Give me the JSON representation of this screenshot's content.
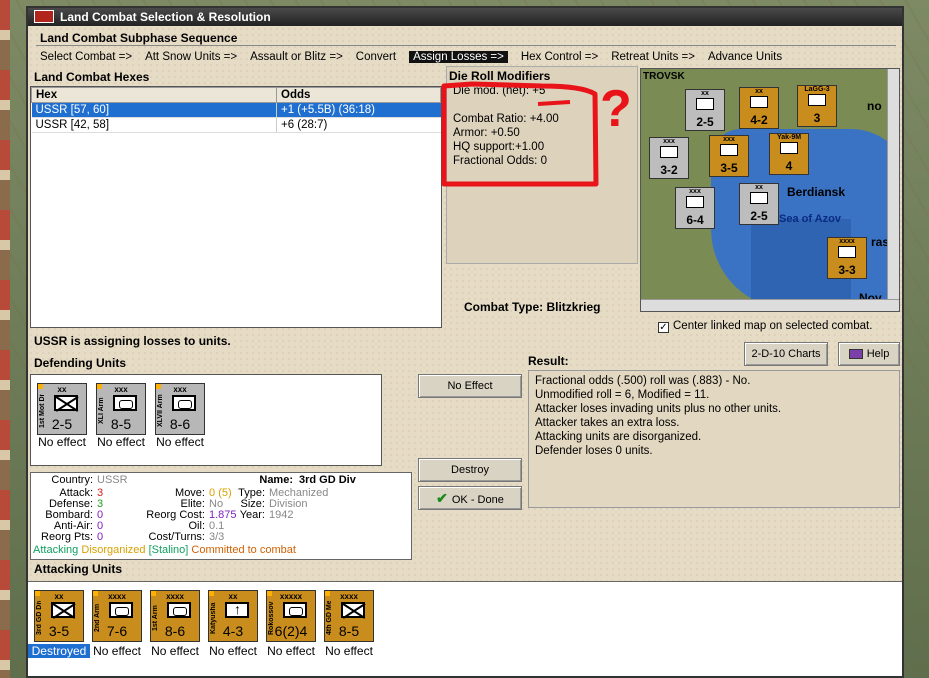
{
  "window": {
    "title": "Land Combat Selection & Resolution"
  },
  "subphase": {
    "heading": "Land Combat Subphase Sequence",
    "steps": [
      "Select Combat =>",
      "Att Snow Units =>",
      "Assault or Blitz =>",
      "Convert",
      "Assign Losses =>",
      "Hex Control =>",
      "Retreat Units =>",
      "Advance Units"
    ],
    "active_index": 4
  },
  "hexes": {
    "heading": "Land Combat Hexes",
    "columns": [
      "Hex",
      "Odds"
    ],
    "rows": [
      {
        "hex": "USSR [57, 60]",
        "odds": "+1 (+5.5B) (36:18)"
      },
      {
        "hex": "USSR [42, 58]",
        "odds": "+6 (28:7)"
      }
    ]
  },
  "die_roll": {
    "heading": "Die Roll Modifiers",
    "net": "Die mod. (net): +5",
    "combat_ratio": "Combat Ratio: +4.00",
    "armor": "Armor: +0.50",
    "hq_support": "HQ support:+1.00",
    "fractional_odds": "Fractional Odds: 0"
  },
  "annotation": {
    "mark": "?",
    "color": "#e8141a"
  },
  "combat_type": "Combat Type:  Blitzkrieg",
  "center_map": {
    "label": "Center linked map on selected combat.",
    "checked": "✓"
  },
  "minimap": {
    "labels": {
      "city": "Berdiansk",
      "sea": "Sea of Azov",
      "frag1": "TROVSK",
      "frag2": "no",
      "frag3": "ras",
      "frag4": "Nov"
    },
    "counters": [
      {
        "value": "2-5",
        "top": "xx"
      },
      {
        "value": "4-2",
        "top": "xx"
      },
      {
        "value": "3",
        "top": "LaGG-3"
      },
      {
        "value": "3-2",
        "top": "xxx"
      },
      {
        "value": "3-5",
        "top": "xxx"
      },
      {
        "value": "4",
        "top": "Yak-9M"
      },
      {
        "value": "6-4",
        "top": "xxx"
      },
      {
        "value": "2-5",
        "top": "xx"
      },
      {
        "value": "3-3",
        "top": "xxxx"
      }
    ]
  },
  "status_text": "USSR is assigning losses to units.",
  "defending": {
    "heading": "Defending Units",
    "units": [
      {
        "size": "xx",
        "name": "1st Mot Div",
        "strength": "2-5",
        "effect": "No effect",
        "symbol": "x",
        "color": "grey"
      },
      {
        "size": "xxx",
        "name": "XLI Arm",
        "strength": "8-5",
        "effect": "No effect",
        "symbol": "box",
        "color": "grey"
      },
      {
        "size": "xxx",
        "name": "XLVII Arm",
        "strength": "8-6",
        "effect": "No effect",
        "symbol": "box",
        "color": "grey"
      }
    ]
  },
  "buttons": {
    "no_effect": "No Effect",
    "destroy": "Destroy",
    "ok_done": "OK - Done",
    "charts": "2-D-10 Charts",
    "help": "Help"
  },
  "result": {
    "heading": "Result:",
    "lines": [
      "Fractional odds (.500) roll was (.883)  - No.",
      "Unmodified roll = 6, Modified = 11.",
      "Attacker loses invading units plus no other units.",
      "Attacker takes an extra loss.",
      "Attacking units are disorganized.",
      "Defender loses 0 units."
    ]
  },
  "unit_info": {
    "country_label": "Country:",
    "country": "USSR",
    "attack_label": "Attack:",
    "attack": "3",
    "defense_label": "Defense:",
    "defense": "3",
    "bombard_label": "Bombard:",
    "bombard": "0",
    "antiair_label": "Anti-Air:",
    "antiair": "0",
    "reorg_label": "Reorg Pts:",
    "reorg": "0",
    "move_label": "Move:",
    "move": "0",
    "move_paren": "(5)",
    "elite_label": "Elite:",
    "elite": "No",
    "reorg_cost_label": "Reorg Cost:",
    "reorg_cost": "1.875",
    "oil_label": "Oil:",
    "oil": "0.1",
    "cost_label": "Cost/Turns:",
    "cost": "3/3",
    "name_label": "Name:",
    "name": "3rd GD Div",
    "type_label": "Type:",
    "type": "Mechanized",
    "size_label": "Size:",
    "size": "Division",
    "year_label": "Year:",
    "year": "1942",
    "status_attacking": "Attacking",
    "status_disorganized": "Disorganized",
    "status_stalino": "[Stalino]",
    "status_committed": "Committed to combat"
  },
  "attacking": {
    "heading": "Attacking Units",
    "units": [
      {
        "size": "xx",
        "name": "3rd GD Div",
        "strength": "3-5",
        "effect": "Destroyed",
        "symbol": "x"
      },
      {
        "size": "xxxx",
        "name": "2nd Arm",
        "strength": "7-6",
        "effect": "No effect",
        "symbol": "box"
      },
      {
        "size": "xxxx",
        "name": "1st Arm",
        "strength": "8-6",
        "effect": "No effect",
        "symbol": "box"
      },
      {
        "size": "xx",
        "name": "Katyusha",
        "strength": "4-3",
        "effect": "No effect",
        "symbol": "art"
      },
      {
        "size": "xxxxx",
        "name": "Rokossovsky",
        "strength": "6(2)4",
        "effect": "No effect",
        "symbol": "box"
      },
      {
        "size": "xxxx",
        "name": "4th GD Mech",
        "strength": "8-5",
        "effect": "No effect",
        "symbol": "x"
      }
    ]
  },
  "colors": {
    "selection": "#1f6fd0",
    "attack": "#d02020",
    "defense": "#20a020",
    "purple": "#8020c0",
    "disorganized": "#d8a000",
    "committed": "#d06000",
    "attacking": "#10a060"
  }
}
